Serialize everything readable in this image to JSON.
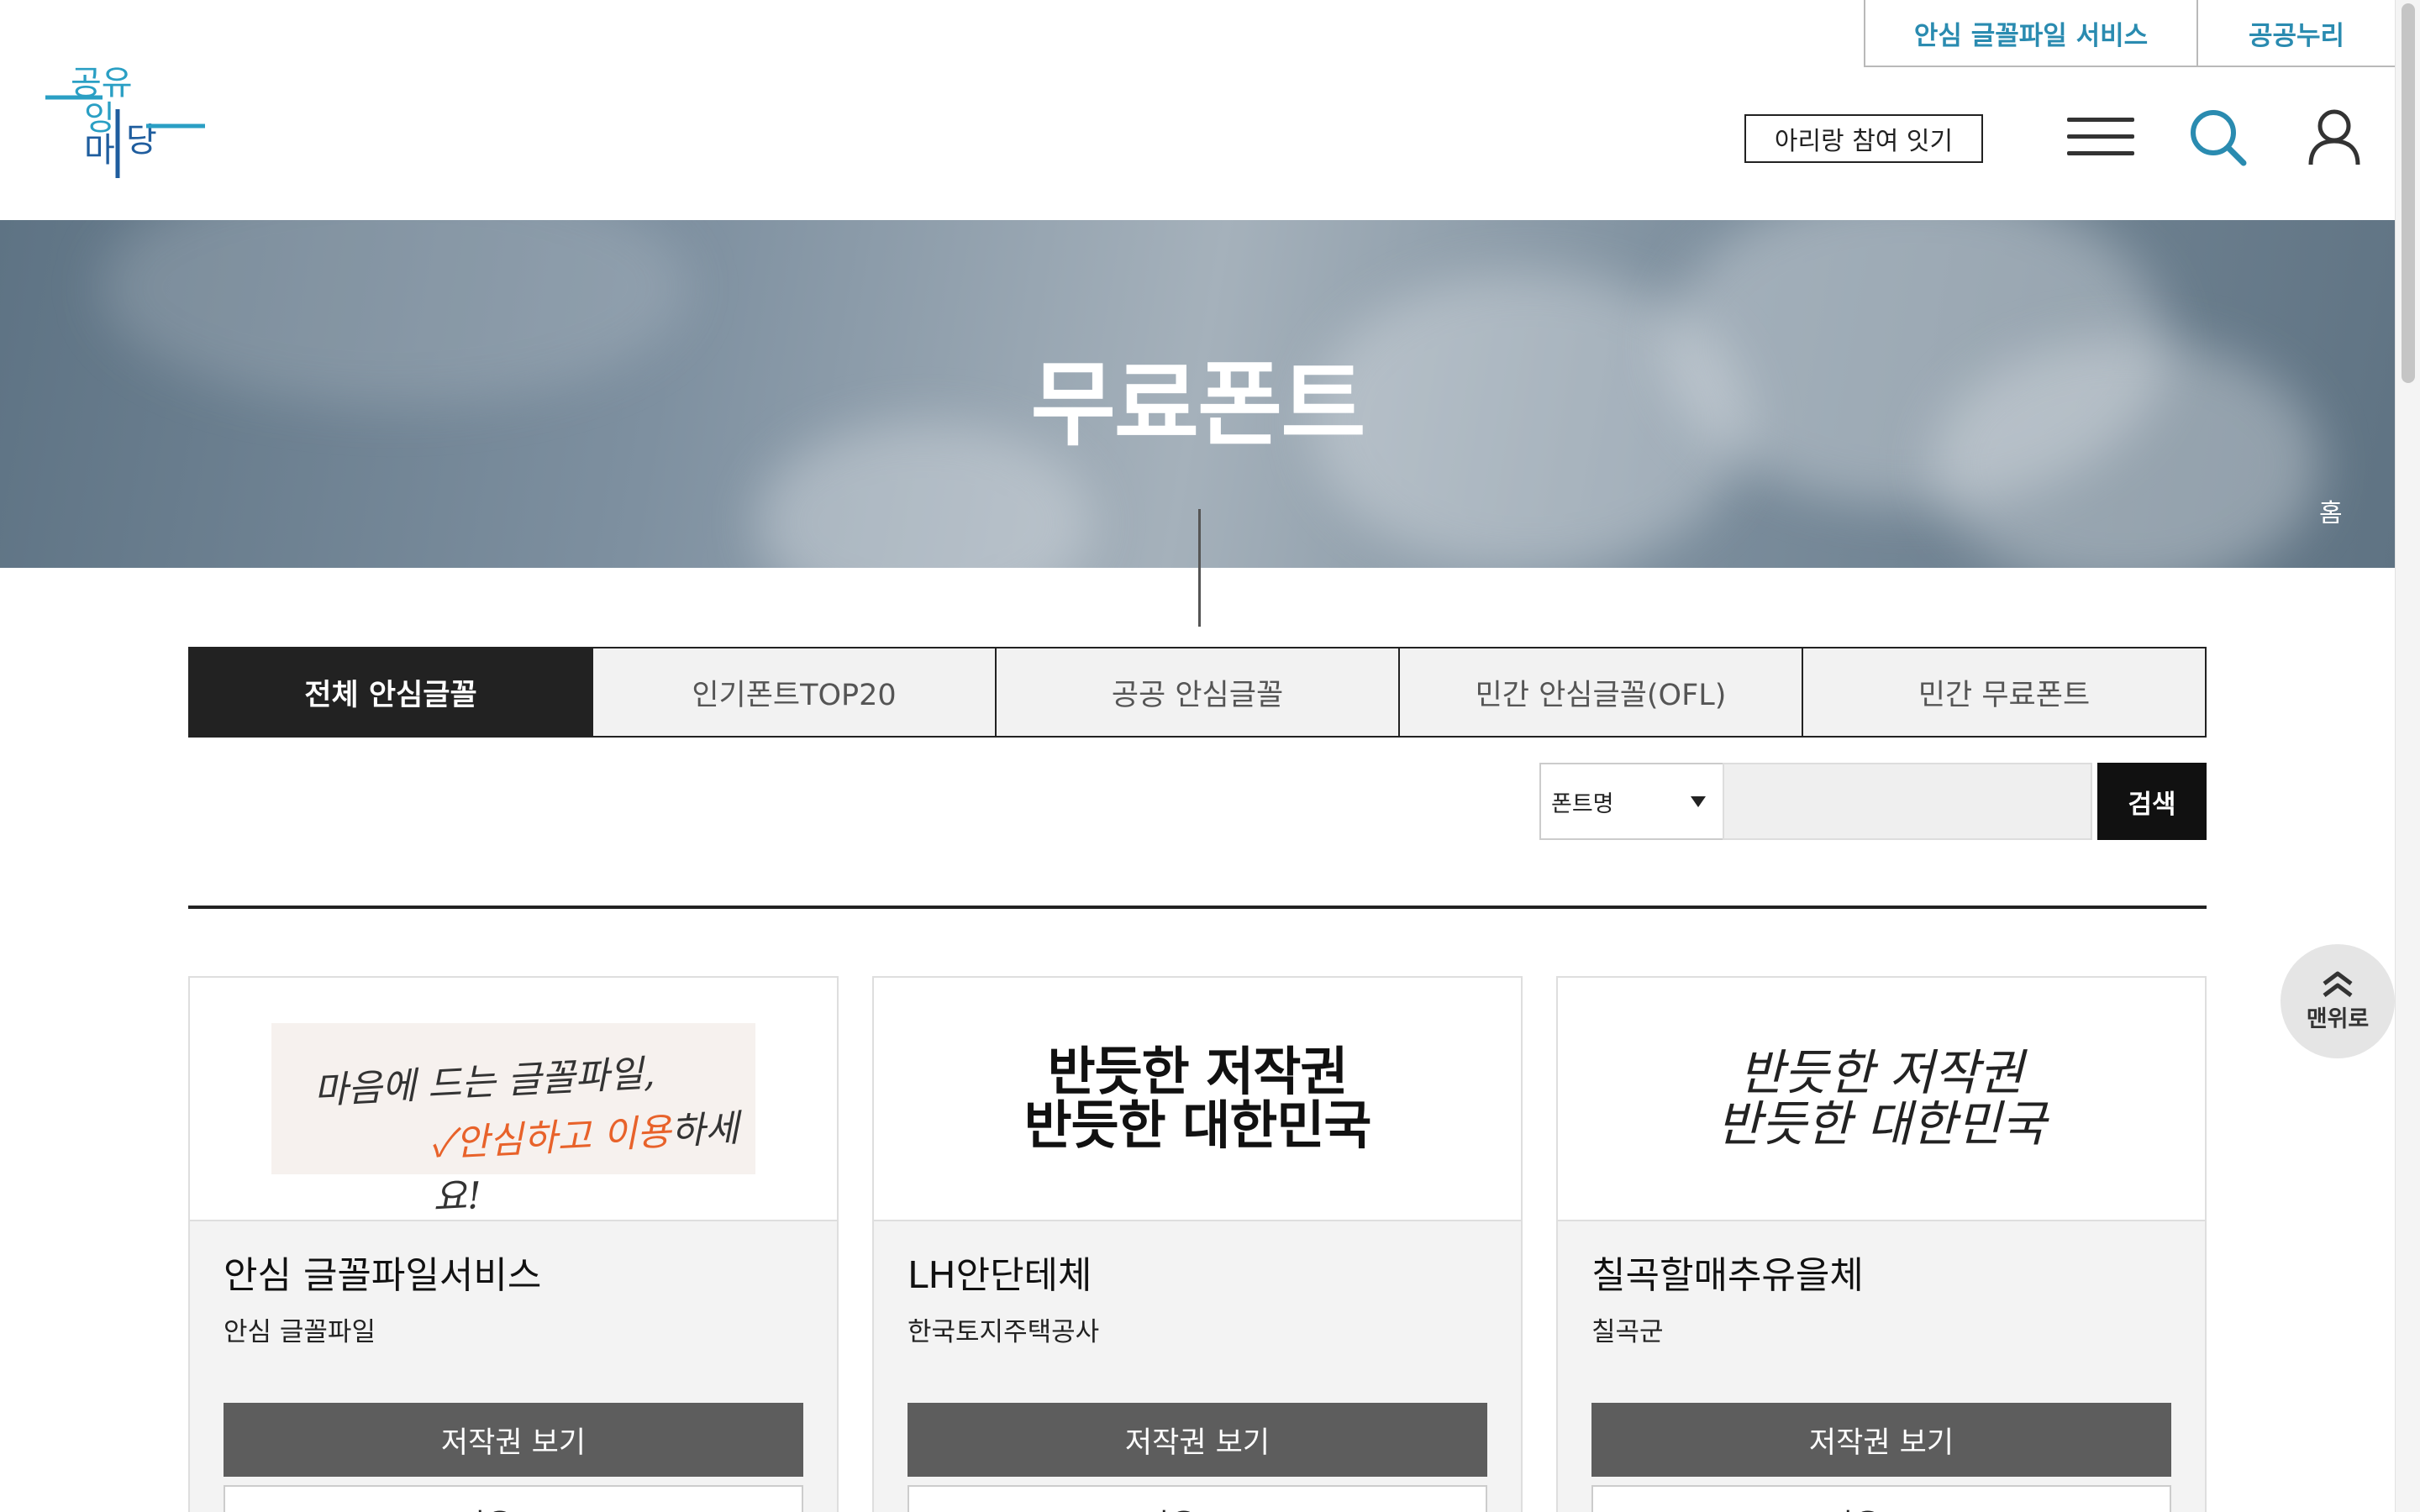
{
  "header": {
    "logo_alt": "공유마당",
    "top_links": [
      "안심 글꼴파일 서비스",
      "공공누리"
    ],
    "arirang_button": "아리랑 참여 잇기",
    "icons": {
      "menu": "hamburger-menu-icon",
      "search": "search-icon",
      "user": "user-icon"
    }
  },
  "hero": {
    "title": "무료폰트",
    "breadcrumb_home": "홈"
  },
  "tabs": [
    {
      "label": "전체 안심글꼴",
      "active": true
    },
    {
      "label": "인기폰트TOP20",
      "active": false
    },
    {
      "label": "공공 안심글꼴",
      "active": false
    },
    {
      "label": "민간 안심글꼴(OFL)",
      "active": false
    },
    {
      "label": "민간 무료폰트",
      "active": false
    }
  ],
  "search": {
    "select_value": "폰트명",
    "input_value": "",
    "button_label": "검색"
  },
  "cards": [
    {
      "name": "안심 글꼴파일서비스",
      "org": "안심 글꼴파일",
      "preview": {
        "line1": "마음에 드는 글꼴파일,",
        "line2_accent": "✓안심하고 이용",
        "line2_rest": "하세요!"
      },
      "copyright_button": "저작권 보기",
      "download_button": "다운로드"
    },
    {
      "name": "LH안단테체",
      "org": "한국토지주택공사",
      "preview": {
        "line1": "반듯한 저작권",
        "line2": "반듯한 대한민국"
      },
      "copyright_button": "저작권 보기",
      "download_button": "다운로드"
    },
    {
      "name": "칠곡할매추유을체",
      "org": "칠곡군",
      "preview": {
        "line1": "반듯한 저작권",
        "line2": "반듯한 대한민국"
      },
      "copyright_button": "저작권 보기",
      "download_button": "다운로드"
    }
  ],
  "back_to_top": "맨위로",
  "colors": {
    "accent": "#2a8bb0",
    "active_tab": "#222222",
    "card_button": "#5d5d5d",
    "logo_teal": "#2a9fc4",
    "logo_blue": "#1f5d9e"
  }
}
